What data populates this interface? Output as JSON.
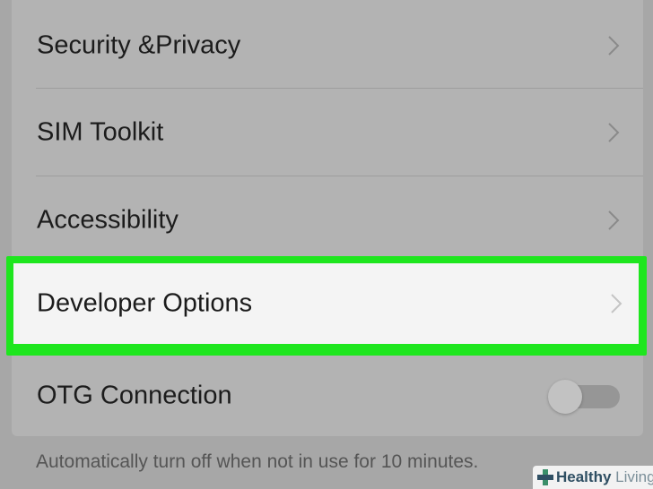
{
  "settings_list": {
    "items": [
      {
        "label": "Security &Privacy",
        "icon": "chevron-right-icon"
      },
      {
        "label": "SIM Toolkit",
        "icon": "chevron-right-icon"
      },
      {
        "label": "Accessibility",
        "icon": "chevron-right-icon"
      },
      {
        "label": "Developer Options",
        "icon": "chevron-right-icon",
        "highlighted": true
      },
      {
        "label": "OTG Connection",
        "control": "toggle",
        "state": "off"
      }
    ],
    "footer_note": "Automatically turn off when not in use for 10 minutes."
  },
  "watermark": {
    "text_bold": "Healthy",
    "text_light": "Living",
    "icon": "medical-cross-icon"
  },
  "colors": {
    "highlight": "#1ee61e",
    "dim_background": "#a7a7a7",
    "highlighted_row_bg": "#f4f4f4"
  }
}
